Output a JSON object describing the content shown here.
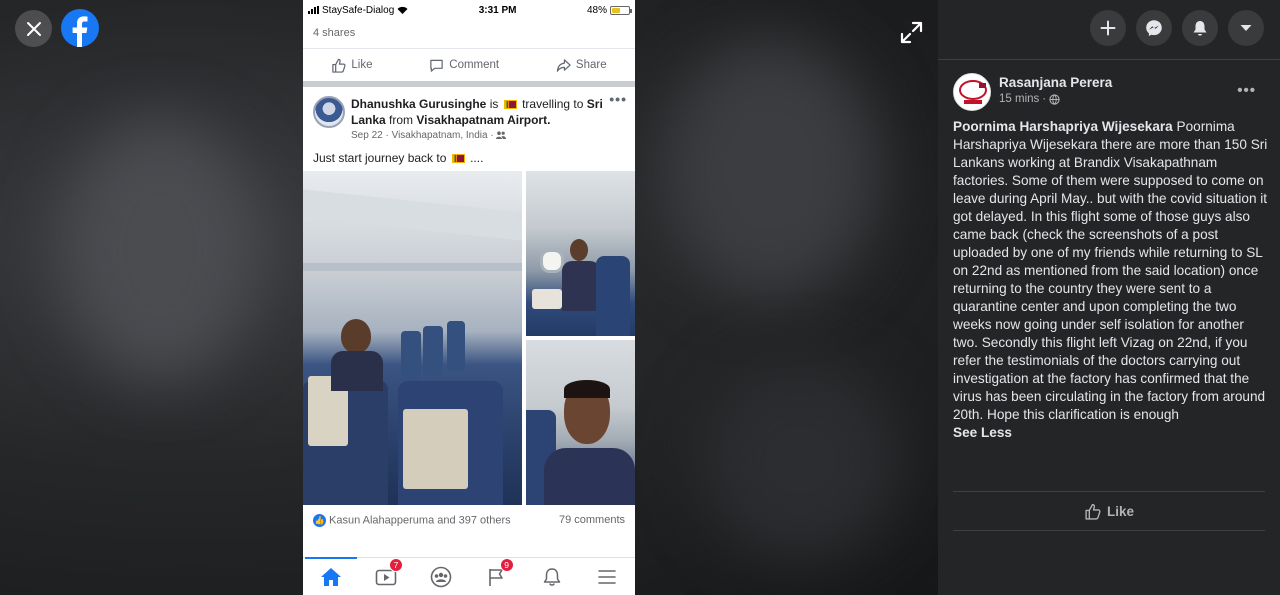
{
  "viewer": {
    "close_icon": "close-icon",
    "logo_icon": "facebook-logo-icon",
    "expand_icon": "expand-icon"
  },
  "phone": {
    "status": {
      "carrier": "StaySafe-Dialog",
      "time": "3:31 PM",
      "battery": "48%",
      "battery_level": 0.48
    },
    "shares": "4 shares",
    "actions": {
      "like": "Like",
      "comment": "Comment",
      "share": "Share"
    },
    "post": {
      "author": "Dhanushka Gurusinghe",
      "is": "is",
      "activity": "travelling to",
      "destination": "Sri Lanka",
      "from": "from",
      "origin": "Visakhapatnam Airport.",
      "date": "Sep 22",
      "location": "Visakhapatnam, India",
      "text": "Just start journey back to",
      "ellipsis": "...."
    },
    "reactions": {
      "names": "Kasun Alahapperuma and 397 others",
      "comments": "79 comments"
    },
    "tabs": [
      {
        "name": "home",
        "badge": ""
      },
      {
        "name": "watch",
        "badge": "7"
      },
      {
        "name": "groups",
        "badge": ""
      },
      {
        "name": "pages",
        "badge": "9"
      },
      {
        "name": "notifications",
        "badge": ""
      },
      {
        "name": "menu",
        "badge": ""
      }
    ]
  },
  "panel": {
    "author": "Rasanjana Perera",
    "time": "15 mins",
    "privacy_icon": "globe-icon",
    "comment_author": "Poornima Harshapriya Wijesekara",
    "comment_text": "Poornima Harshapriya Wijesekara there are more than 150 Sri Lankans working at Brandix Visakapathnam factories. Some of them were supposed to come on leave during April May.. but with the covid situation it got delayed. In this flight some of those guys also came back (check the screenshots of a post uploaded by one of my friends while returning to SL on 22nd as mentioned from the said location) once returning to the country they were sent to a quarantine center and upon completing the two weeks now going under self isolation for another two. Secondly this flight left Vizag on 22nd, if you refer the testimonials of the doctors carrying out investigation at the factory has confirmed that the virus has been circulating in the factory from around 20th. Hope this clarification is enough",
    "see_less": "See Less",
    "like": "Like"
  },
  "topbar": [
    "plus-icon",
    "messenger-icon",
    "bell-icon",
    "caret-down-icon"
  ],
  "colors": {
    "accent": "#1877f2",
    "panel_bg": "#242526",
    "badge": "#e41e3f"
  }
}
